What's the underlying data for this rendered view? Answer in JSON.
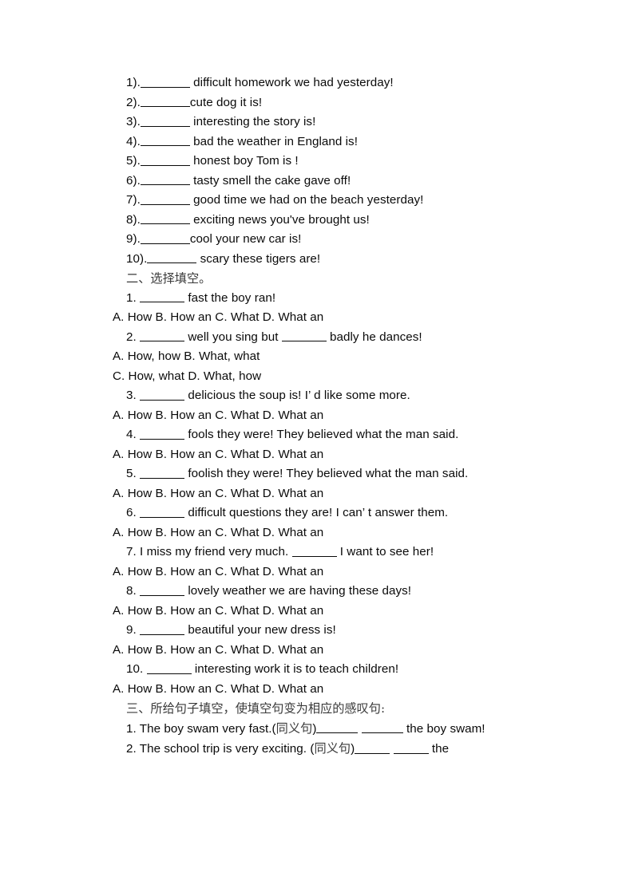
{
  "document": {
    "background_color": "#ffffff",
    "text_color": "#0a0a0a",
    "heading_color": "#3a3a3a"
  },
  "section_one": {
    "items": [
      {
        "number": "1).",
        "text": " difficult homework we had yesterday!"
      },
      {
        "number": "2).",
        "text": "cute dog it is!"
      },
      {
        "number": "3).",
        "text": " interesting the story is!"
      },
      {
        "number": "4).",
        "text": " bad the weather in England is!"
      },
      {
        "number": "5).",
        "text": " honest boy Tom is !"
      },
      {
        "number": "6).",
        "text": " tasty smell the cake gave off!"
      },
      {
        "number": "7).",
        "text": " good time we had on the beach yesterday!"
      },
      {
        "number": "8).",
        "text": " exciting news you've brought us!"
      },
      {
        "number": "9).",
        "text": "cool your new car is!"
      },
      {
        "number": "10).",
        "text": " scary these tigers are!"
      }
    ]
  },
  "section_two": {
    "heading": "二、选择填空。",
    "options_standard": "A. How B. How an C. What D. What an",
    "items": [
      {
        "number": "1.",
        "pre": " ",
        "post": " fast the boy ran!",
        "options": [
          "A. How B. How an C. What D. What an"
        ]
      },
      {
        "number": "2.",
        "pre": " ",
        "mid": " well you sing but ",
        "post": " badly he dances!",
        "options": [
          "A. How, how B. What, what",
          "C. How, what D. What, how"
        ]
      },
      {
        "number": "3.",
        "pre": " ",
        "post": " delicious the soup is! I’ d like some more.",
        "options": [
          "A. How B. How an C. What D. What an"
        ]
      },
      {
        "number": "4.",
        "pre": " ",
        "post": " fools they were! They believed what the man said.",
        "options": [
          "A. How B. How an C. What D. What an"
        ]
      },
      {
        "number": "5.",
        "pre": " ",
        "post": " foolish they were! They believed what the man said.",
        "options": [
          "A. How B. How an C. What D. What an"
        ]
      },
      {
        "number": "6.",
        "pre": " ",
        "post": " difficult questions they are! I can’ t answer them.",
        "options": [
          "A. How B. How an C. What D. What an"
        ]
      },
      {
        "number": "7.",
        "pre": " I miss my friend very much. ",
        "post": " I want to see her!",
        "options": [
          "A. How B. How an C. What D. What an"
        ]
      },
      {
        "number": "8.",
        "pre": " ",
        "post": " lovely weather we are having these days!",
        "options": [
          "A. How B. How an C. What D. What an"
        ]
      },
      {
        "number": "9.",
        "pre": " ",
        "post": " beautiful your new dress is!",
        "options": [
          "A. How B. How an C. What D. What an"
        ]
      },
      {
        "number": "10.",
        "pre": " ",
        "post": " interesting work it is to teach children!",
        "options": [
          "A. How B. How an C. What D. What an"
        ]
      }
    ]
  },
  "section_three": {
    "heading": "三、所给句子填空，使填空句变为相应的感叹句:",
    "items": [
      {
        "number": "1.",
        "pre": " The boy swam very fast.(",
        "cn": "同义句",
        "mid": ")",
        "post": " the boy swam!"
      },
      {
        "number": "2.",
        "pre": " The school trip is very exciting. (",
        "cn": "同义句",
        "mid": ")",
        "post": " the"
      }
    ]
  }
}
